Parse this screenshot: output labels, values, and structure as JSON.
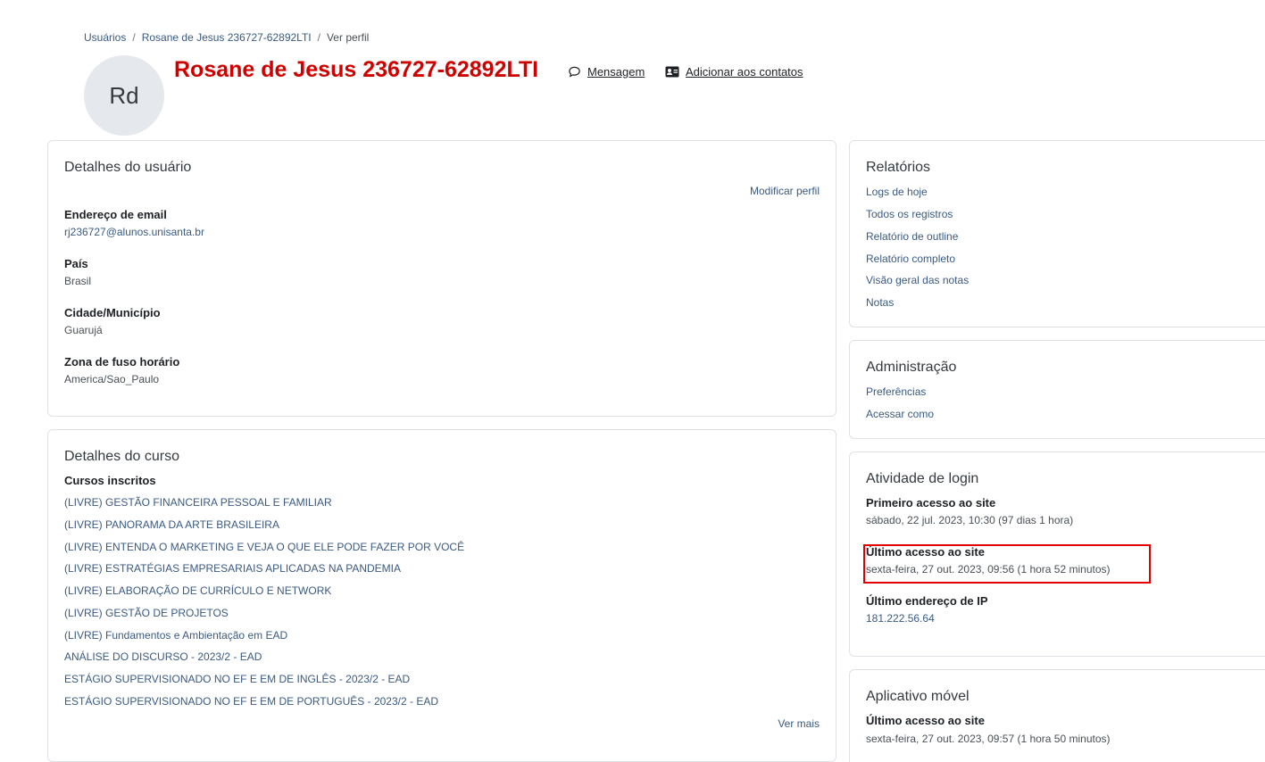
{
  "breadcrumb": {
    "items": [
      "Usuários",
      "Rosane de Jesus 236727-62892LTI",
      "Ver perfil"
    ],
    "separator": "/"
  },
  "header": {
    "avatar_initials": "Rd",
    "name": "Rosane de Jesus 236727-62892LTI",
    "message_label": "Mensagem",
    "add_contact_label": "Adicionar aos contatos"
  },
  "user_details": {
    "title": "Detalhes do usuário",
    "edit_label": "Modificar perfil",
    "fields": [
      {
        "label": "Endereço de email",
        "value": "rj236727@alunos.unisanta.br"
      },
      {
        "label": "País",
        "value": "Brasil"
      },
      {
        "label": "Cidade/Município",
        "value": "Guarujá"
      },
      {
        "label": "Zona de fuso horário",
        "value": "America/Sao_Paulo"
      }
    ]
  },
  "course_details": {
    "title": "Detalhes do curso",
    "enrolled_label": "Cursos inscritos",
    "courses": [
      "(LIVRE) GESTÃO FINANCEIRA PESSOAL E FAMILIAR",
      "(LIVRE) PANORAMA DA ARTE BRASILEIRA",
      "(LIVRE) ENTENDA O MARKETING E VEJA O QUE ELE PODE FAZER POR VOCÊ",
      "(LIVRE) ESTRATÉGIAS EMPRESARIAIS APLICADAS NA PANDEMIA",
      "(LIVRE) ELABORAÇÃO DE CURRÍCULO E NETWORK",
      "(LIVRE) GESTÃO DE PROJETOS",
      "(LIVRE) Fundamentos e Ambientação em EAD",
      "ANÁLISE DO DISCURSO - 2023/2 - EAD",
      "ESTÁGIO SUPERVISIONADO NO EF E EM DE INGLÊS - 2023/2 - EAD",
      "ESTÁGIO SUPERVISIONADO NO EF E EM DE PORTUGUÊS - 2023/2 - EAD"
    ],
    "more_label": "Ver mais"
  },
  "reports": {
    "title": "Relatórios",
    "links": [
      "Logs de hoje",
      "Todos os registros",
      "Relatório de outline",
      "Relatório completo",
      "Visão geral das notas",
      "Notas"
    ]
  },
  "administration": {
    "title": "Administração",
    "links": [
      "Preferências",
      "Acessar como"
    ]
  },
  "login_activity": {
    "title": "Atividade de login",
    "first_access_label": "Primeiro acesso ao site",
    "first_access_value": "sábado, 22 jul. 2023, 10:30  (97 dias 1 hora)",
    "last_access_label": "Último acesso ao site",
    "last_access_value": "sexta-feira, 27 out. 2023, 09:56  (1 hora 52 minutos)",
    "last_ip_label": "Último endereço de IP",
    "last_ip_value": "181.222.56.64"
  },
  "mobile_app": {
    "title": "Aplicativo móvel",
    "last_access_label": "Último acesso ao site",
    "last_access_value": "sexta-feira, 27 out. 2023, 09:57  (1 hora 50 minutos)"
  },
  "colors": {
    "name_red": "#d10000",
    "link_blue": "#3a5a82",
    "highlight_red": "#e00000"
  }
}
